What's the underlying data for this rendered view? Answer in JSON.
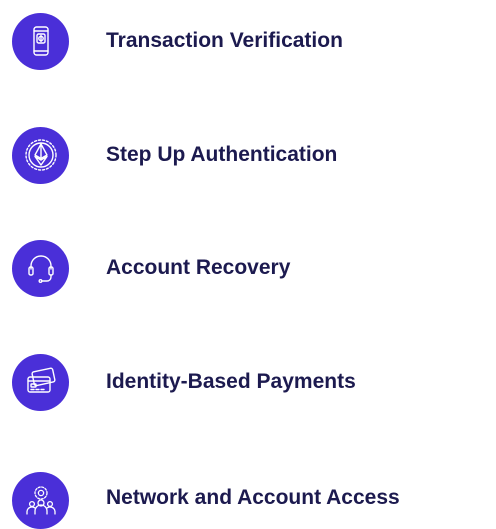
{
  "colors": {
    "icon_background": "#4a2fd8",
    "icon_stroke": "#ffffff",
    "label_text": "#1c1a4f",
    "page_background": "#ffffff"
  },
  "features": [
    {
      "label": "Transaction Verification",
      "icon": "mobile-phone-payment-icon"
    },
    {
      "label": "Step Up Authentication",
      "icon": "ethereum-coin-icon"
    },
    {
      "label": "Account Recovery",
      "icon": "headset-support-icon"
    },
    {
      "label": "Identity-Based Payments",
      "icon": "credit-cards-icon"
    },
    {
      "label": "Network and Account Access",
      "icon": "user-group-network-icon"
    }
  ]
}
